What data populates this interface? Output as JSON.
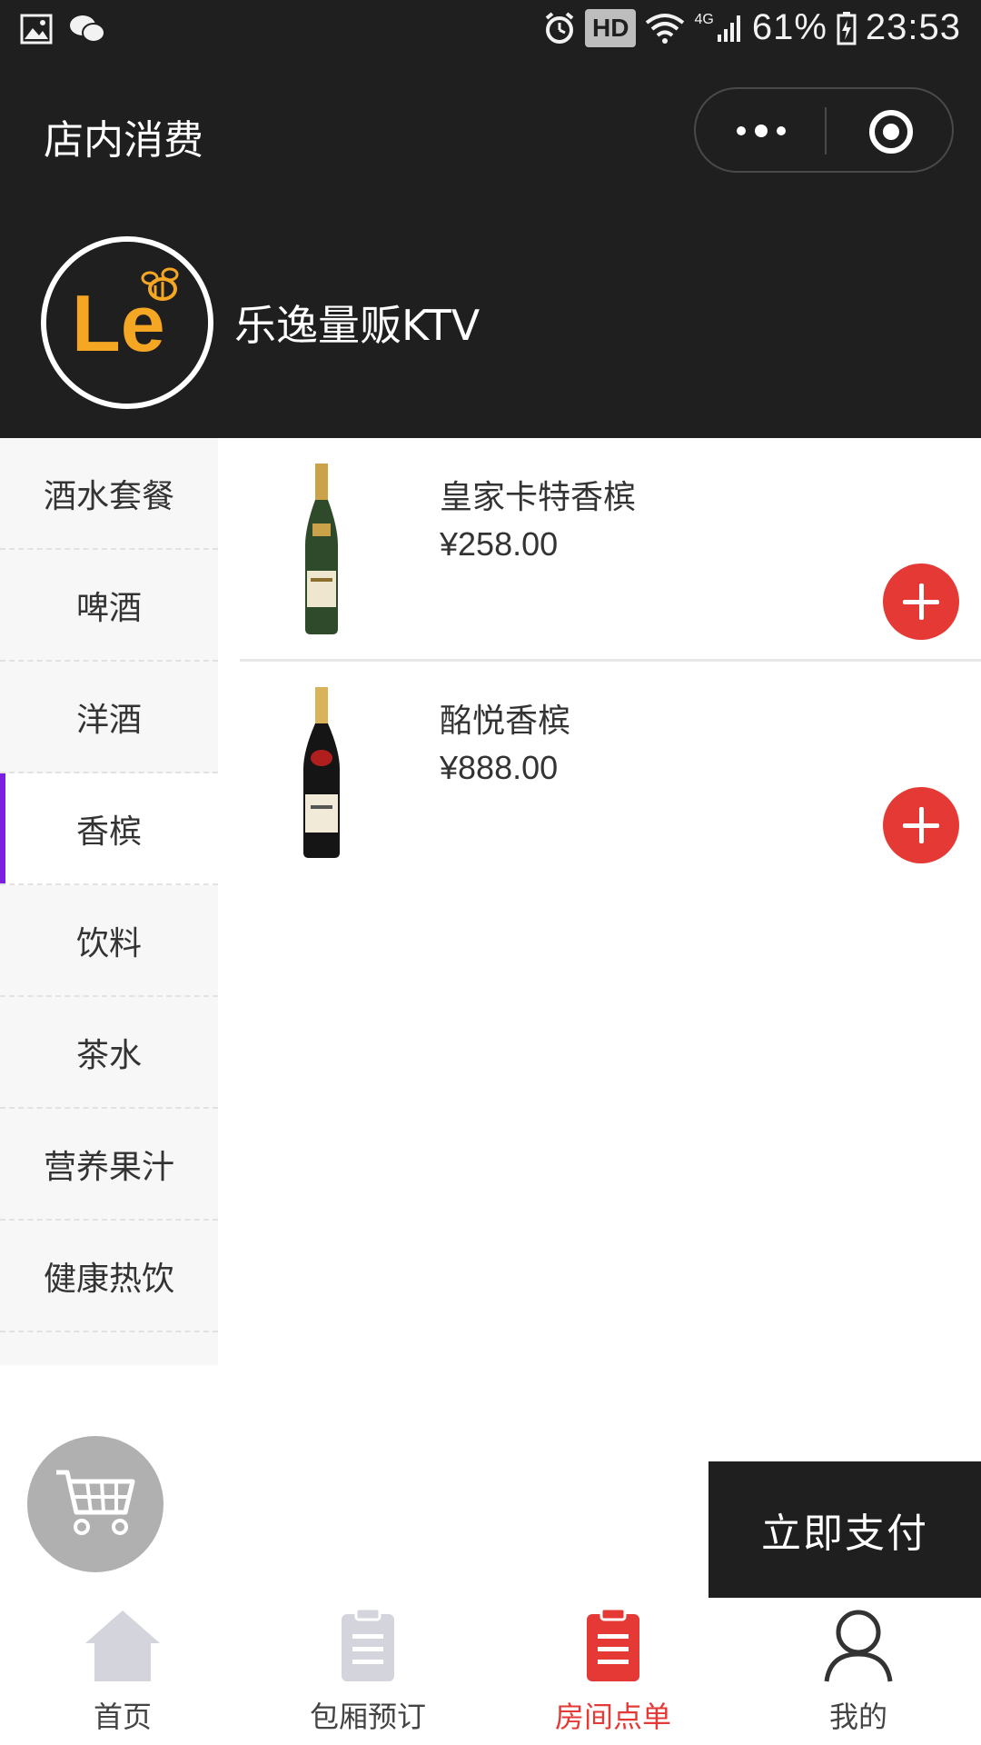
{
  "status_bar": {
    "hd_badge": "HD",
    "network_label": "4G",
    "battery_percent": "61%",
    "time": "23:53"
  },
  "nav_bar": {
    "title": "店内消费"
  },
  "shop": {
    "name": "乐逸量贩KTV",
    "logo_text": "Le"
  },
  "categories": [
    {
      "label": "酒水套餐",
      "active": false
    },
    {
      "label": "啤酒",
      "active": false
    },
    {
      "label": "洋酒",
      "active": false
    },
    {
      "label": "香槟",
      "active": true
    },
    {
      "label": "饮料",
      "active": false
    },
    {
      "label": "茶水",
      "active": false
    },
    {
      "label": "营养果汁",
      "active": false
    },
    {
      "label": "健康热饮",
      "active": false
    }
  ],
  "products": [
    {
      "name": "皇家卡特香槟",
      "price": "¥258.00",
      "image_icon": "champagne-bottle-gold-icon"
    },
    {
      "name": "酩悦香槟",
      "price": "¥888.00",
      "image_icon": "champagne-bottle-black-icon"
    }
  ],
  "pay_button": {
    "label": "立即支付"
  },
  "tab_bar": {
    "items": [
      {
        "label": "首页",
        "icon": "home-icon",
        "active": false
      },
      {
        "label": "包厢预订",
        "icon": "clipboard-icon",
        "active": false
      },
      {
        "label": "房间点单",
        "icon": "clipboard-icon",
        "active": true
      },
      {
        "label": "我的",
        "icon": "user-icon",
        "active": false
      }
    ]
  },
  "colors": {
    "header_bg": "#1f1f1f",
    "accent_red": "#e53935",
    "active_indicator": "#7b1fe0",
    "logo_orange": "#f5a623"
  }
}
